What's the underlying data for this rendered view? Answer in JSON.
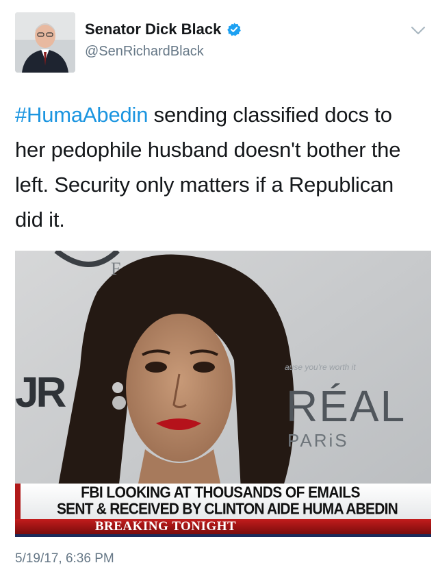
{
  "author": {
    "display_name": "Senator Dick Black",
    "handle": "@SenRichardBlack",
    "verified": true
  },
  "tweet": {
    "hashtag": "#HumaAbedin",
    "text": " sending classified docs to her pedophile husband doesn't bother the left. Security only matters if a Republican did it.",
    "timestamp": "5/19/17, 6:36 PM"
  },
  "media": {
    "background_fragments": {
      "left_letters": "JR",
      "slogan": "ause you're worth it",
      "brand": "RÉAL",
      "city": "PARiS"
    },
    "chyron": {
      "line1": "FBI LOOKING AT THOUSANDS OF EMAILS",
      "line2": "SENT & RECEIVED BY CLINTON AIDE HUMA ABEDIN",
      "banner": "BREAKING TONIGHT"
    }
  },
  "colors": {
    "hashtag": "#1b95e0",
    "verified_badge": "#1da1f2",
    "secondary_text": "#657786",
    "chyron_red": "#c21c1c"
  },
  "icons": {
    "verified": "verified-badge-icon",
    "caret": "chevron-down-icon"
  }
}
